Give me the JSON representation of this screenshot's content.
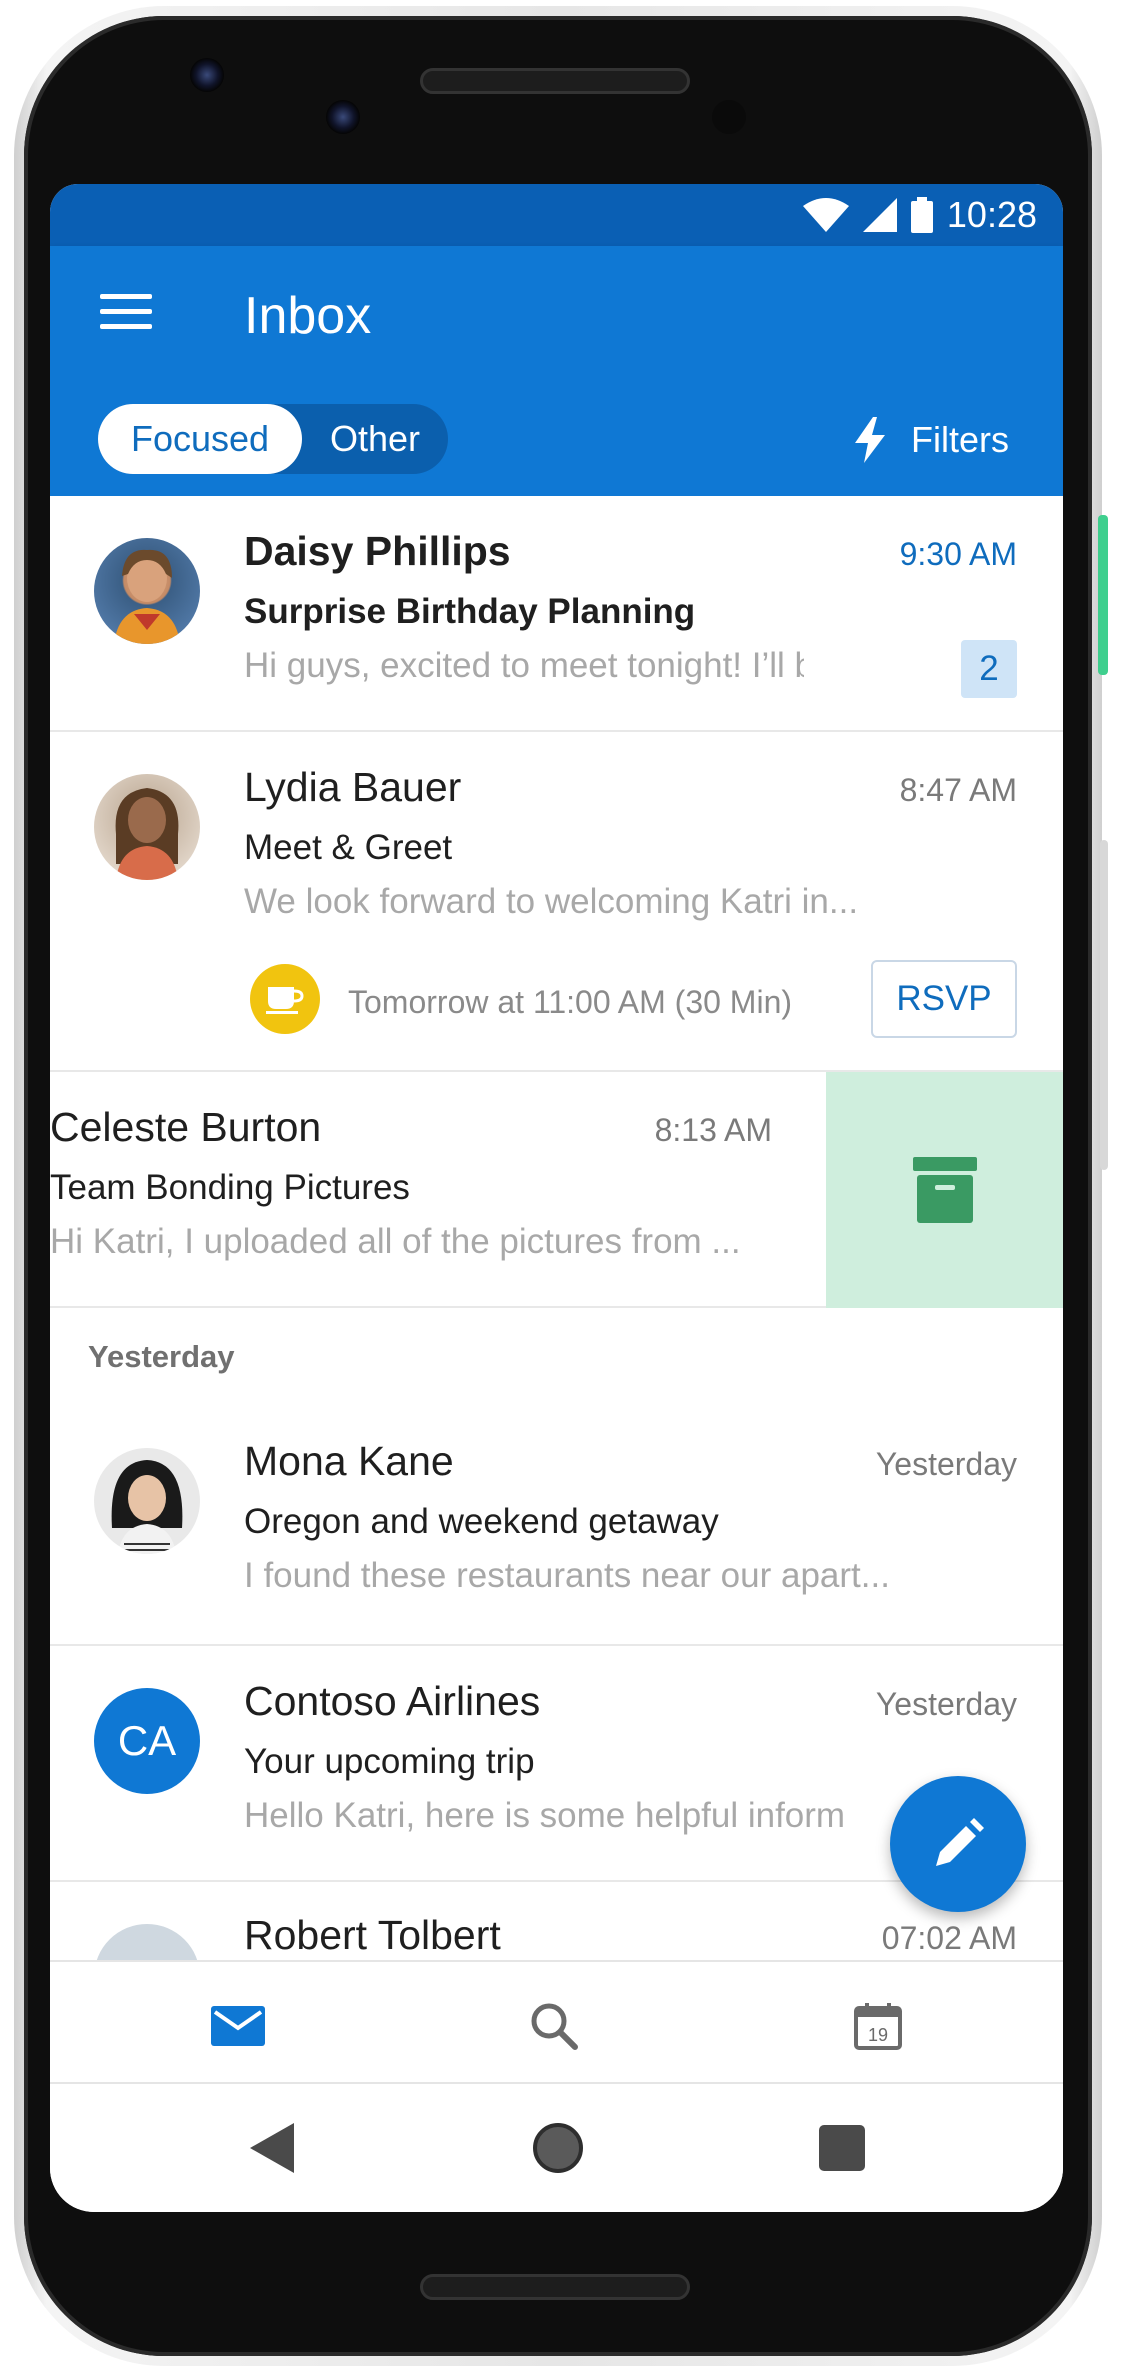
{
  "status_bar": {
    "time": "10:28"
  },
  "app_bar": {
    "title": "Inbox",
    "tabs": [
      {
        "label": "Focused",
        "selected": true
      },
      {
        "label": "Other",
        "selected": false
      }
    ],
    "filters_label": "Filters"
  },
  "messages": [
    {
      "sender": "Daisy Phillips",
      "time": "9:30 AM",
      "subject": "Surprise Birthday Planning",
      "preview": "Hi guys, excited to meet tonight! I’ll be...",
      "unread": true,
      "count": "2"
    },
    {
      "sender": "Lydia Bauer",
      "time": "8:47 AM",
      "subject": "Meet & Greet",
      "preview": "We look forward to welcoming Katri in...",
      "event_text": "Tomorrow at 11:00 AM (30 Min)",
      "rsvp_label": "RSVP"
    },
    {
      "sender": "Celeste Burton",
      "time": "8:13 AM",
      "subject": "Team Bonding Pictures",
      "preview": "Hi Katri, I uploaded all of the pictures from ..."
    }
  ],
  "section_yesterday": "Yesterday",
  "messages_yesterday": [
    {
      "sender": "Mona Kane",
      "time": "Yesterday",
      "subject": "Oregon and weekend getaway",
      "preview": "I found these restaurants near our apart..."
    },
    {
      "sender": "Contoso Airlines",
      "initials": "CA",
      "time": "Yesterday",
      "subject": "Your upcoming trip",
      "preview": "Hello Katri, here is some helpful inform"
    },
    {
      "sender": "Robert Tolbert",
      "time": "07:02 AM"
    }
  ],
  "bottom_nav": {
    "items": [
      {
        "icon": "mail-icon",
        "active": true
      },
      {
        "icon": "search-icon",
        "active": false
      },
      {
        "icon": "calendar-icon",
        "active": false,
        "day": "19"
      }
    ]
  },
  "icons": {
    "menu": "hamburger-menu-icon",
    "filters": "lightning-bolt-icon",
    "archive": "archive-icon",
    "compose": "pencil-icon",
    "event": "coffee-cup-icon"
  },
  "colors": {
    "app_bar": "#0f78d4",
    "status_bar": "#0a5fb4",
    "accent_text": "#0f6cbd",
    "archive_swipe": "#cfeedd",
    "archive_icon": "#3a9a63",
    "event_icon": "#f1c40f"
  }
}
